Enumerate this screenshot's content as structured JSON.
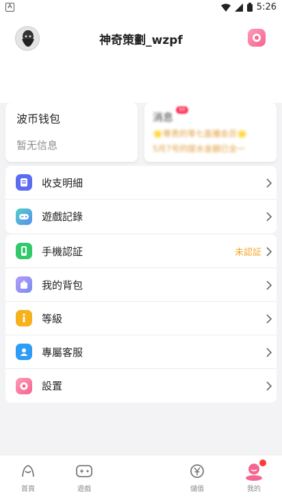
{
  "status_bar": {
    "time": "5:26",
    "left_glyph": "A"
  },
  "profile": {
    "username": "神奇策劃_wzpf"
  },
  "wallet": {
    "title": "波币钱包",
    "subtitle": "暂无信息"
  },
  "messages": {
    "title": "消息",
    "badge": "99",
    "line1": "🌟尊贵的零七直播会员🌟",
    "line2": "5月7号的提水金額已全一"
  },
  "menu_group_1": [
    {
      "label": "收支明細",
      "icon": "ledger-icon",
      "color": "#5b6cf0"
    },
    {
      "label": "遊戲記錄",
      "icon": "gamepad-icon",
      "color": "#3fc2e6"
    }
  ],
  "menu_group_2": [
    {
      "label": "手機認証",
      "icon": "phone-icon",
      "color": "#32c96a",
      "value": "未認証"
    },
    {
      "label": "我的背包",
      "icon": "bag-icon",
      "color": "#8a7af5"
    },
    {
      "label": "等級",
      "icon": "info-icon",
      "color": "#f6b21c"
    },
    {
      "label": "專屬客服",
      "icon": "user-icon",
      "color": "#2f9cf5"
    },
    {
      "label": "設置",
      "icon": "gear-icon",
      "color": "#f56592"
    }
  ],
  "tabs": [
    {
      "label": "首頁",
      "icon": "home-icon"
    },
    {
      "label": "遊戲",
      "icon": "game-icon"
    },
    {
      "label": "儲值",
      "icon": "yuan-icon"
    },
    {
      "label": "我的",
      "icon": "profile-icon",
      "active": true
    }
  ]
}
